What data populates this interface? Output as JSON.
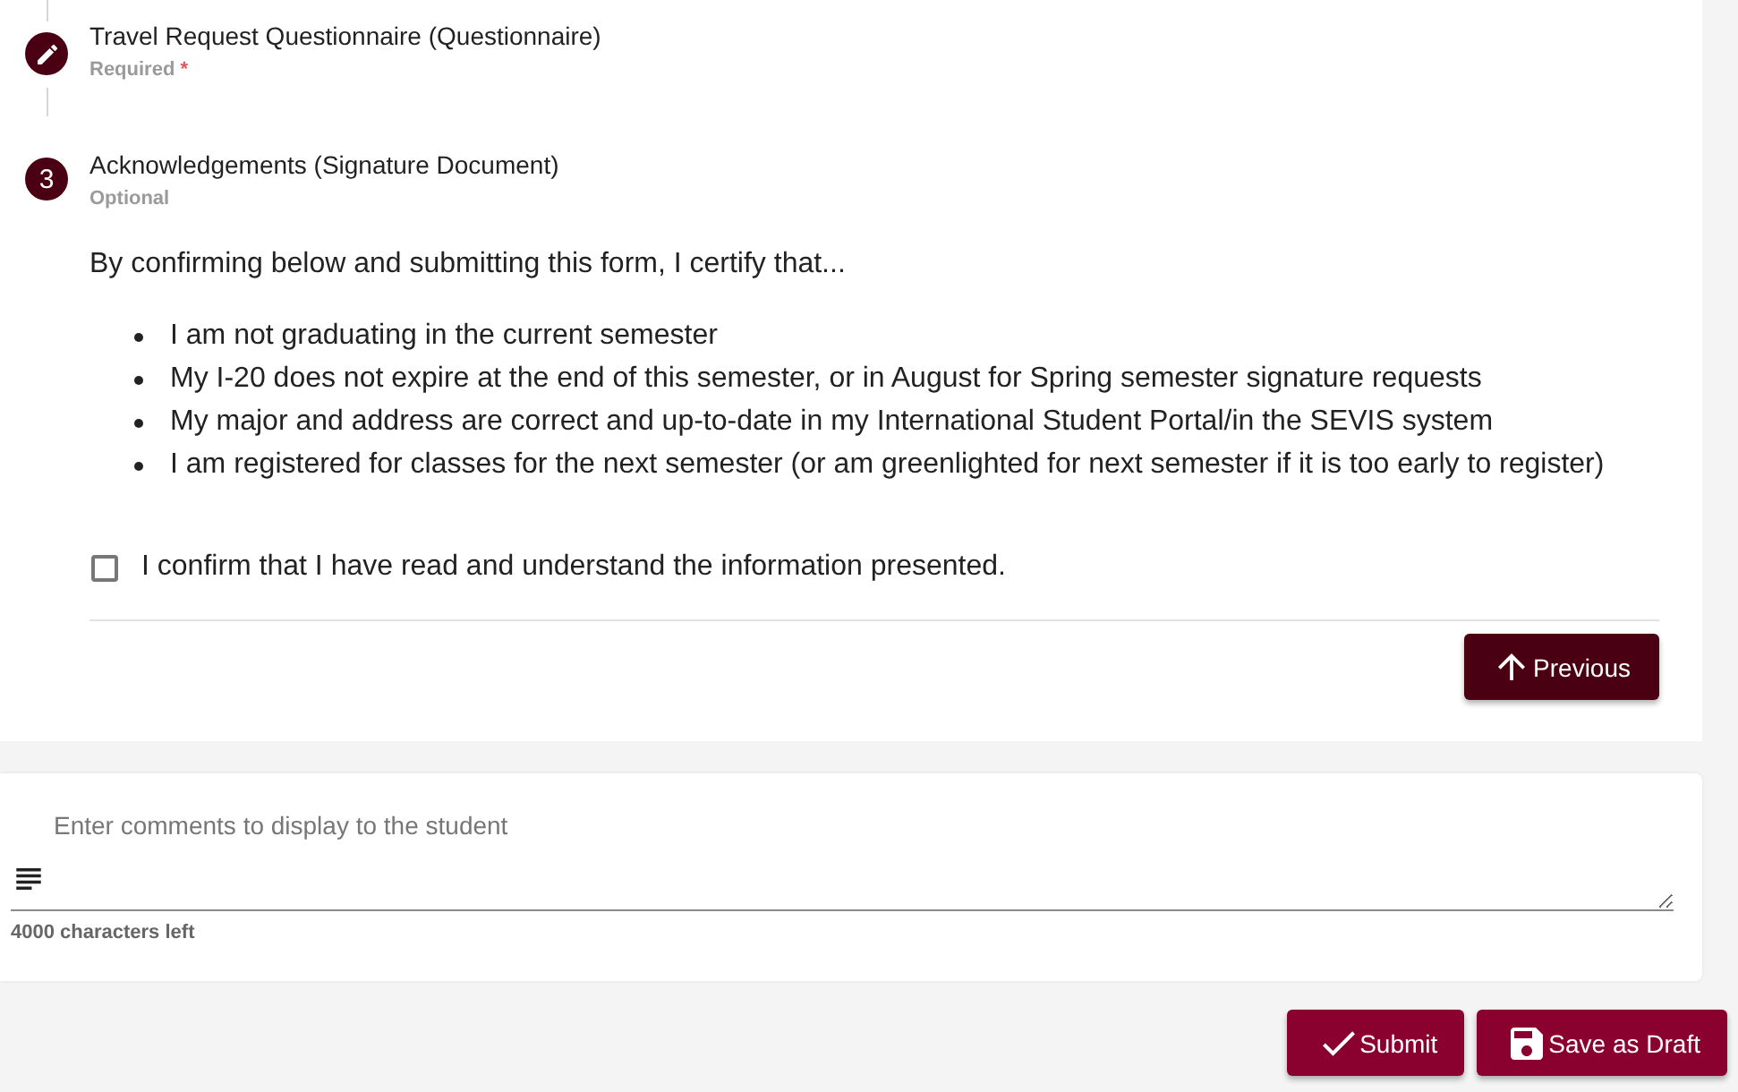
{
  "stepper": {
    "steps": [
      {
        "kind": "edit",
        "title": "Travel Request Questionnaire (Questionnaire)",
        "status": "Required",
        "required_mark": "*"
      },
      {
        "kind": "number",
        "number": "3",
        "title": "Acknowledgements (Signature Document)",
        "status": "Optional"
      }
    ]
  },
  "acknowledgement": {
    "intro": "By confirming below and submitting this form, I certify that...",
    "items": [
      "I am not graduating in the current semester",
      "My I-20 does not expire at the end of this semester, or in August for Spring semester signature requests",
      "My major and address are correct and up-to-date in my International Student Portal/in the SEVIS system",
      "I am registered for classes for the next semester (or am greenlighted for next semester if it is too early to register)"
    ],
    "confirm": {
      "label": "I confirm that I have read and understand the information presented.",
      "checked": false
    }
  },
  "navigation": {
    "previous_button": {
      "label": "Previous"
    }
  },
  "comments": {
    "placeholder": "Enter comments to display to the student",
    "counter": "4000 characters left"
  },
  "actions": [
    {
      "kind": "submit",
      "label": "Submit"
    },
    {
      "kind": "save_draft",
      "label": "Save as Draft"
    }
  ]
}
